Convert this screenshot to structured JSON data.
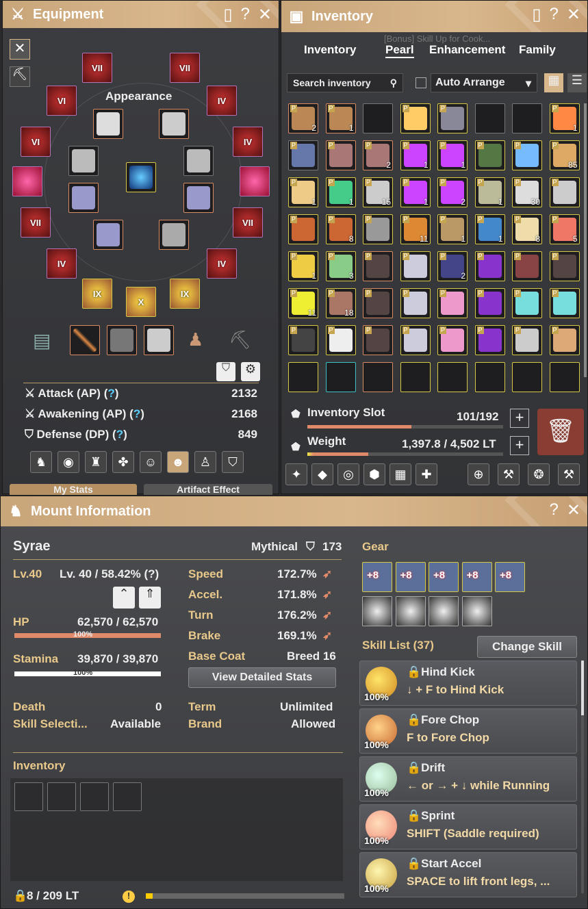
{
  "equipment": {
    "title": "Equipment",
    "appearance_label": "Appearance",
    "slots": {
      "top_l": "VII",
      "top_r": "VII",
      "r2_l": "VI",
      "r2_r": "IV",
      "r3_l": "VI",
      "r3_r": "IV",
      "r5_l": "VII",
      "r5_r": "VII",
      "r6_l": "IV",
      "r6_r": "IV",
      "bot_l": "IX",
      "bot_m": "X",
      "bot_r": "IX"
    },
    "stats": [
      {
        "label": "Attack (AP)",
        "value": "2132"
      },
      {
        "label": "Awakening (AP)",
        "value": "2168"
      },
      {
        "label": "Defense (DP)",
        "value": "849"
      }
    ],
    "question": "?",
    "bottom_left_btn": "My Stats",
    "bottom_right_btn": "Artifact Effect"
  },
  "inventory": {
    "title": "Inventory",
    "bg_text": "[Bonus] Skill Up for Cook...",
    "tabs": [
      "Inventory",
      "Pearl",
      "Enhancement",
      "Family"
    ],
    "search_placeholder": "Search inventory",
    "auto_arrange": "Auto Arrange",
    "counts": [
      "2",
      "1",
      "",
      "",
      "",
      "",
      "",
      "1",
      "",
      "",
      "2",
      "1",
      "1",
      "",
      "",
      "85",
      "1",
      "1",
      "15",
      "1",
      "2",
      "1",
      "30",
      "",
      "",
      "8",
      "",
      "11",
      "1",
      "1",
      "8",
      "5",
      "1",
      "3",
      "",
      "",
      "2",
      "",
      "",
      "",
      "11",
      "18",
      "",
      "",
      "",
      "",
      "",
      "",
      "",
      "",
      "",
      "",
      "",
      "",
      "",
      ""
    ],
    "slot_label": "Inventory Slot",
    "slot_value": "101/192",
    "weight_label": "Weight",
    "weight_value": "1,397.8 / 4,502 LT",
    "slot_fill": 0.53,
    "weight_fill": 0.31
  },
  "mount": {
    "title": "Mount Information",
    "name": "Syrae",
    "grade": "Mythical",
    "grade_value": "173",
    "level": "Lv.40",
    "level_detail": "Lv. 40 / 58.42% (?)",
    "hp_label": "HP",
    "hp_value": "62,570 / 62,570",
    "hp_pct": "100%",
    "stamina_label": "Stamina",
    "stamina_value": "39,870 / 39,870",
    "stamina_pct": "100%",
    "speed_label": "Speed",
    "speed": "172.7%",
    "accel_label": "Accel.",
    "accel": "171.8%",
    "turn_label": "Turn",
    "turn": "176.2%",
    "brake_label": "Brake",
    "brake": "169.1%",
    "base_coat_label": "Base Coat",
    "breed": "Breed 16",
    "detail_btn": "View Detailed Stats",
    "death_label": "Death",
    "death": "0",
    "skill_sel_label": "Skill Selecti...",
    "skill_sel": "Available",
    "term_label": "Term",
    "term": "Unlimited",
    "brand_label": "Brand",
    "brand": "Allowed",
    "inventory_label": "Inventory",
    "weight": "8 / 209 LT",
    "gear_label": "Gear",
    "gear_plus": [
      "+8",
      "+8",
      "+8",
      "+8",
      "+8"
    ],
    "skill_list_label": "Skill List (37)",
    "change_skill": "Change Skill",
    "skills": [
      {
        "name": "Hind Kick",
        "desc": "↓ + F to Hind Kick",
        "pct": "100%"
      },
      {
        "name": "Fore Chop",
        "desc": "F to Fore Chop",
        "pct": "100%"
      },
      {
        "name": "Drift",
        "desc": "← or → + ↓  while Running",
        "pct": "100%"
      },
      {
        "name": "Sprint",
        "desc": "SHIFT (Saddle required)",
        "pct": "100%"
      },
      {
        "name": "Start Accel",
        "desc": "SPACE to lift front legs, ...",
        "pct": "100%"
      }
    ]
  }
}
